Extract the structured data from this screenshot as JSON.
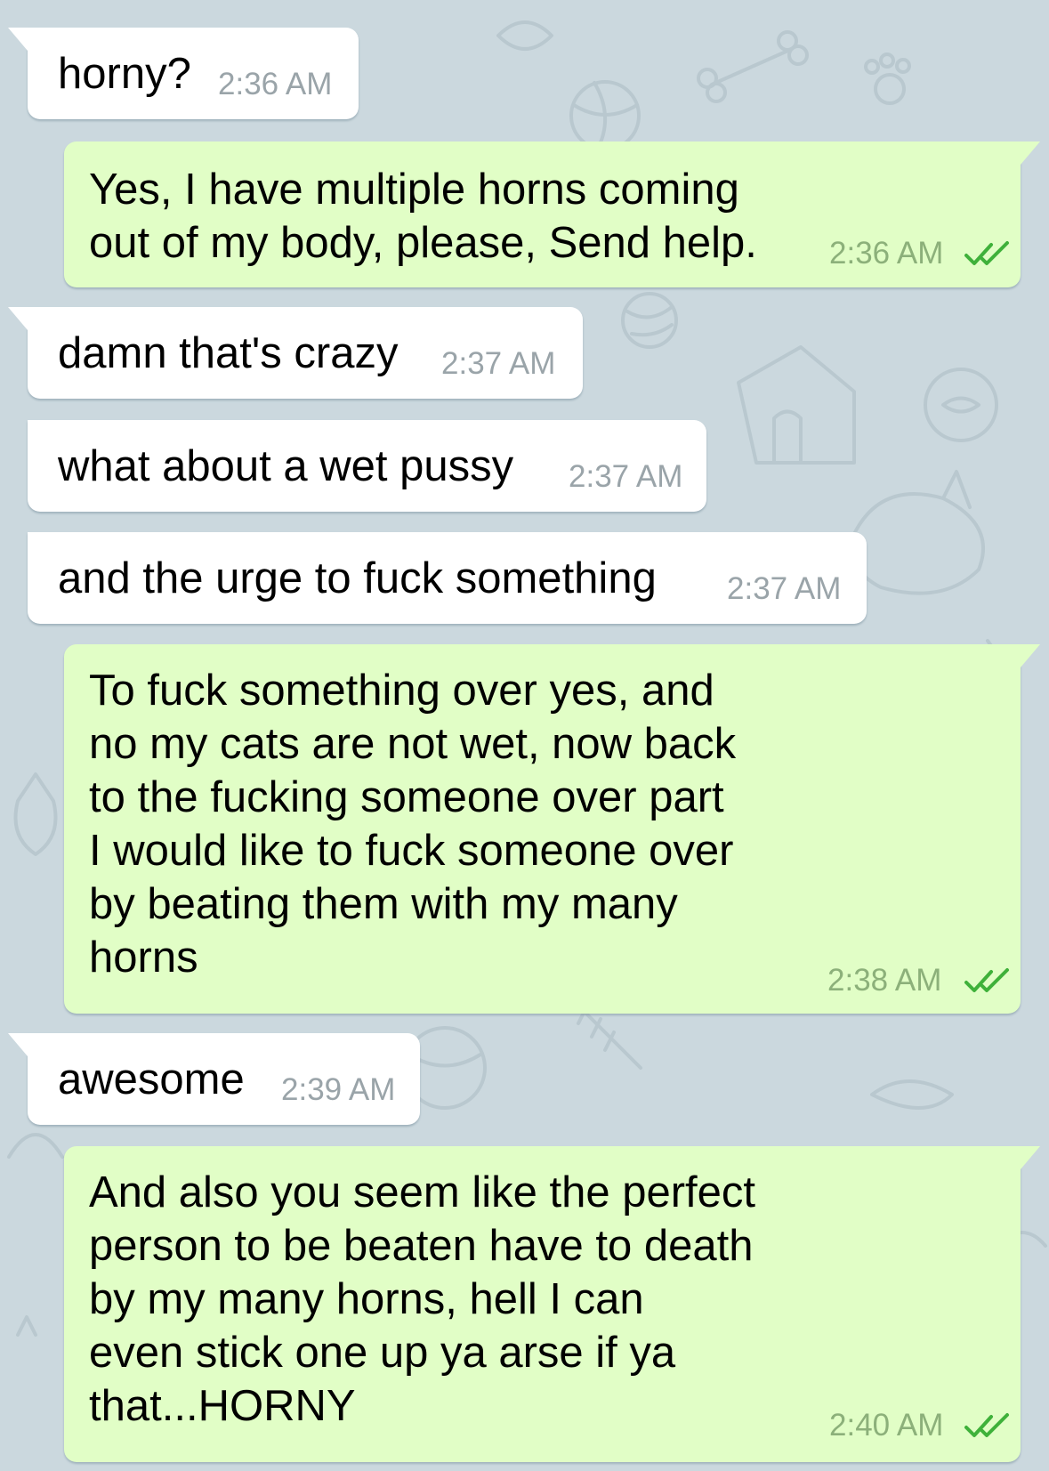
{
  "colors": {
    "background": "#cbd8de",
    "incoming_bubble": "#ffffff",
    "outgoing_bubble": "#e1fec6",
    "incoming_time": "#9aa4a9",
    "outgoing_time": "#8cb07a",
    "read_check": "#3fb13a"
  },
  "messages": [
    {
      "direction": "incoming",
      "text": "horny?",
      "time": "2:36 AM"
    },
    {
      "direction": "outgoing",
      "text": "Yes, I have multiple horns coming\nout of my body, please, Send help.",
      "time": "2:36 AM",
      "status_icon": "double-check-icon"
    },
    {
      "direction": "incoming",
      "text": "damn that's crazy",
      "time": "2:37 AM"
    },
    {
      "direction": "incoming",
      "text": "what about a wet pussy",
      "time": "2:37 AM"
    },
    {
      "direction": "incoming",
      "text": "and the urge to fuck something",
      "time": "2:37 AM"
    },
    {
      "direction": "outgoing",
      "text": "To fuck something over yes, and\nno my cats are not wet, now back\nto the fucking someone over part\nI would like to fuck someone over\nby beating them with my many\nhorns",
      "time": "2:38 AM",
      "status_icon": "double-check-icon"
    },
    {
      "direction": "incoming",
      "text": "awesome",
      "time": "2:39 AM"
    },
    {
      "direction": "outgoing",
      "text": "And also you seem like the perfect\nperson to be beaten have to death\nby my many horns, hell I can\neven stick one up ya arse if ya\nthat...HORNY",
      "time": "2:40 AM",
      "status_icon": "double-check-icon"
    }
  ]
}
